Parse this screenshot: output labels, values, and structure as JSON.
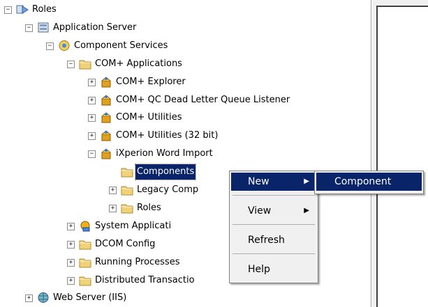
{
  "tree": [
    {
      "label": "Roles",
      "expander": "−",
      "icon": "roles-icon"
    },
    {
      "label": "Application Server",
      "expander": "−",
      "icon": "server-icon"
    },
    {
      "label": "Component Services",
      "expander": "−",
      "icon": "component-services-icon"
    },
    {
      "label": "COM+ Applications",
      "expander": "−",
      "icon": "folder-icon"
    },
    {
      "label": "COM+ Explorer",
      "expander": "+",
      "icon": "com-package-icon"
    },
    {
      "label": "COM+ QC Dead Letter Queue Listener",
      "expander": "+",
      "icon": "com-package-icon"
    },
    {
      "label": "COM+ Utilities",
      "expander": "+",
      "icon": "com-package-icon"
    },
    {
      "label": "COM+ Utilities (32 bit)",
      "expander": "+",
      "icon": "com-package-icon"
    },
    {
      "label": "iXperion Word Import",
      "expander": "−",
      "icon": "com-package-icon"
    },
    {
      "label": "Components",
      "expander": "",
      "icon": "folder-icon"
    },
    {
      "label": "Legacy Comp",
      "expander": "+",
      "icon": "folder-icon"
    },
    {
      "label": "Roles",
      "expander": "+",
      "icon": "folder-icon"
    },
    {
      "label": "System Applicati",
      "expander": "+",
      "icon": "system-app-icon"
    },
    {
      "label": "DCOM Config",
      "expander": "+",
      "icon": "folder-icon"
    },
    {
      "label": "Running Processes",
      "expander": "+",
      "icon": "folder-icon"
    },
    {
      "label": "Distributed Transactio",
      "expander": "+",
      "icon": "folder-icon"
    },
    {
      "label": "Web Server (IIS)",
      "expander": "+",
      "icon": "web-server-icon"
    }
  ],
  "context_menu": {
    "items": [
      "New",
      "View",
      "Refresh",
      "Help"
    ],
    "submenu_arrow": "▶"
  },
  "submenu": {
    "items": [
      "Component"
    ]
  },
  "colors": {
    "selection": "#0a246a",
    "menu_bg": "#f0f0f0",
    "folder": "#f0d27a"
  }
}
